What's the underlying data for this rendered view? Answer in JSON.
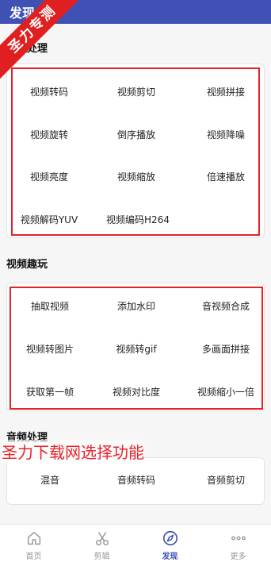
{
  "appbar": {
    "title": "发现"
  },
  "ribbon": {
    "text": "圣力专测"
  },
  "sections": {
    "video_processing": {
      "title": "视频处理",
      "items": [
        "视频转码",
        "视频剪切",
        "视频拼接",
        "视频旋转",
        "倒序播放",
        "视频降噪",
        "视频亮度",
        "视频缩放",
        "倍速播放",
        "视频解码YUV",
        "视频编码H264"
      ]
    },
    "video_fun": {
      "title": "视频趣玩",
      "items": [
        "抽取视频",
        "添加水印",
        "音视频合成",
        "视频转图片",
        "视频转gif",
        "多画面拼接",
        "获取第一帧",
        "视频对比度",
        "视频缩小一倍"
      ]
    },
    "audio_processing": {
      "title": "音频处理",
      "items": [
        "混音",
        "音频转码",
        "音频剪切"
      ]
    }
  },
  "overlay": {
    "text": "圣力下载网选择功能"
  },
  "bottom_nav": {
    "items": [
      {
        "label": "首页",
        "icon": "home-icon"
      },
      {
        "label": "剪辑",
        "icon": "scissors-icon"
      },
      {
        "label": "发现",
        "icon": "discover-icon"
      },
      {
        "label": "更多",
        "icon": "more-icon"
      }
    ],
    "active_index": 2
  },
  "colors": {
    "primary": "#3f51b5",
    "highlight_red": "#e32228"
  }
}
